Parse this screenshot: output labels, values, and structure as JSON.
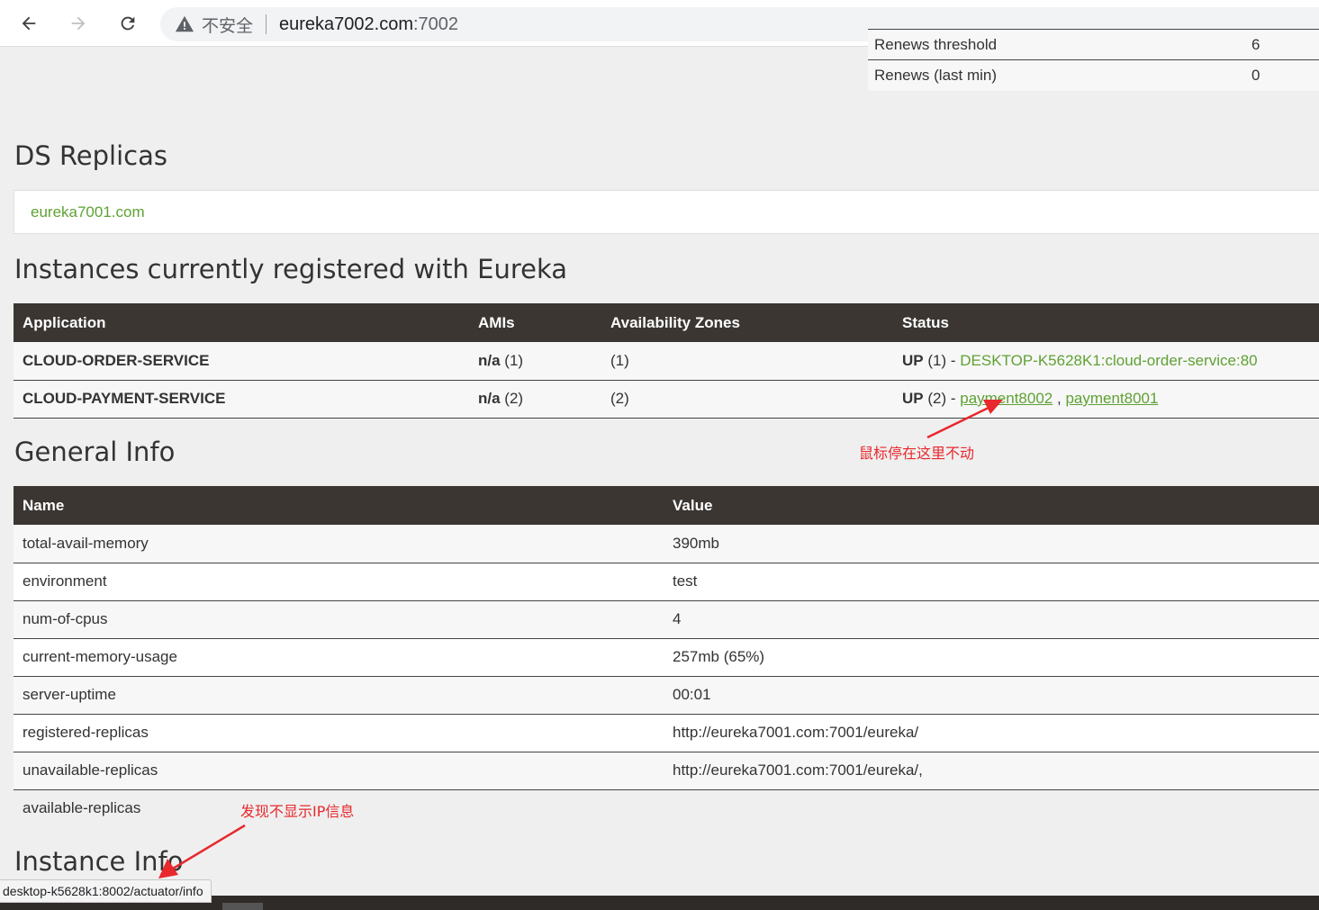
{
  "browser": {
    "back_icon": "arrow-left-icon",
    "forward_icon": "arrow-right-icon",
    "reload_icon": "reload-icon",
    "security_warning": "不安全",
    "url_host": "eureka7002.com",
    "url_port": ":7002"
  },
  "stats": {
    "rows": [
      {
        "name": "Renews threshold",
        "value": "6"
      },
      {
        "name": "Renews (last min)",
        "value": "0"
      }
    ]
  },
  "ds_replicas": {
    "title": "DS Replicas",
    "link": "eureka7001.com"
  },
  "instances": {
    "title": "Instances currently registered with Eureka",
    "headers": [
      "Application",
      "AMIs",
      "Availability Zones",
      "Status"
    ],
    "rows": [
      {
        "application": "CLOUD-ORDER-SERVICE",
        "amis_bold": "n/a",
        "amis_count": " (1)",
        "zones": "(1)",
        "status_bold": "UP",
        "status_rest": " (1) - ",
        "links": [
          "DESKTOP-K5628K1:cloud-order-service:80"
        ]
      },
      {
        "application": "CLOUD-PAYMENT-SERVICE",
        "amis_bold": "n/a",
        "amis_count": " (2)",
        "zones": "(2)",
        "status_bold": "UP",
        "status_rest": " (2) - ",
        "links": [
          "payment8002",
          "payment8001"
        ],
        "link_sep": " , "
      }
    ]
  },
  "general_info": {
    "title": "General Info",
    "headers": [
      "Name",
      "Value"
    ],
    "rows": [
      {
        "name": "total-avail-memory",
        "value": "390mb"
      },
      {
        "name": "environment",
        "value": "test"
      },
      {
        "name": "num-of-cpus",
        "value": "4"
      },
      {
        "name": "current-memory-usage",
        "value": "257mb (65%)"
      },
      {
        "name": "server-uptime",
        "value": "00:01"
      },
      {
        "name": "registered-replicas",
        "value": "http://eureka7001.com:7001/eureka/"
      },
      {
        "name": "unavailable-replicas",
        "value": "http://eureka7001.com:7001/eureka/,"
      },
      {
        "name": "available-replicas",
        "value": ""
      }
    ]
  },
  "instance_info": {
    "title": "Instance Info"
  },
  "annotations": {
    "hover_note": "鼠标停在这里不动",
    "ip_note": "发现不显示IP信息",
    "color": "#e8282d"
  },
  "status_url": "desktop-k5628k1:8002/actuator/info",
  "colors": {
    "header_bg": "#3b3632",
    "link": "#5fa134",
    "page_bg": "#efefef"
  }
}
